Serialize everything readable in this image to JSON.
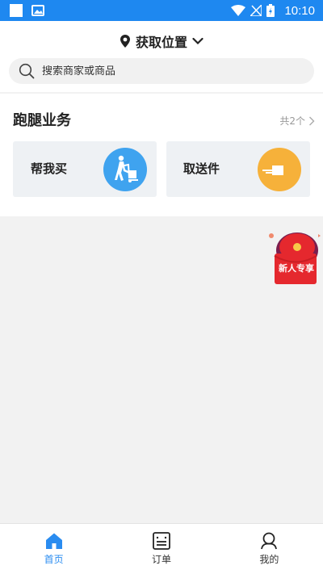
{
  "status_bar": {
    "time": "10:10",
    "icons": [
      "notification-square-icon",
      "image-icon",
      "wifi-icon",
      "signal-off-icon",
      "battery-charging-icon"
    ]
  },
  "header": {
    "location_label": "获取位置",
    "location_icon": "location-pin-icon",
    "dropdown_icon": "chevron-down-icon"
  },
  "search": {
    "placeholder": "搜索商家或商品",
    "value": "",
    "icon": "search-icon"
  },
  "errand_section": {
    "title": "跑腿业务",
    "count_label": "共2个",
    "cards": [
      {
        "label": "帮我买",
        "icon": "hand-truck-delivery-icon",
        "icon_color": "#3fa3ef"
      },
      {
        "label": "取送件",
        "icon": "package-delivery-icon",
        "icon_color": "#f6b13a"
      }
    ]
  },
  "promo": {
    "text": "新人专享",
    "icon": "red-envelope-icon"
  },
  "tabbar": {
    "items": [
      {
        "label": "首页",
        "icon": "home-icon",
        "active": true
      },
      {
        "label": "订单",
        "icon": "order-list-icon",
        "active": false
      },
      {
        "label": "我的",
        "icon": "profile-icon",
        "active": false
      }
    ]
  },
  "colors": {
    "primary": "#1e88f0",
    "tab_active": "#2a8cf0",
    "page_bg": "#f2f2f2",
    "card_bg": "#eef1f4",
    "promo_red": "#e5282e"
  }
}
